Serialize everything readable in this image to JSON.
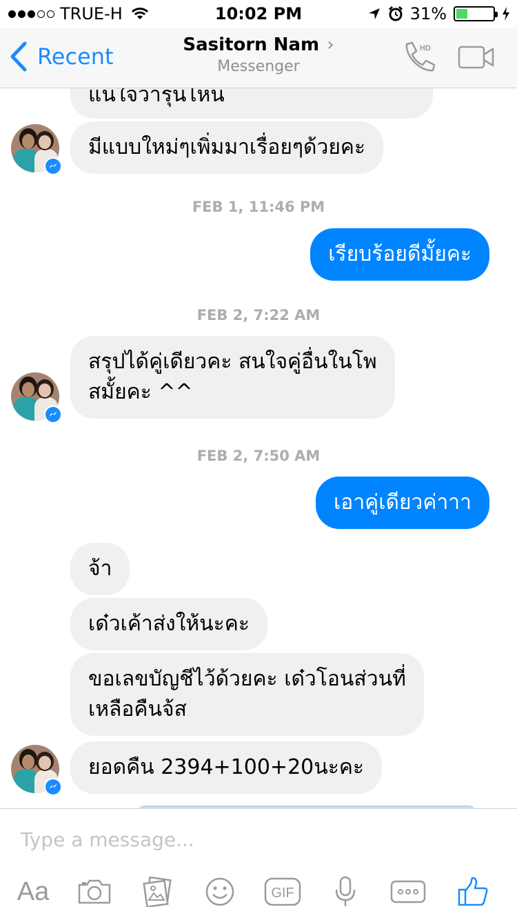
{
  "status_bar": {
    "carrier": "TRUE-H",
    "time": "10:02 PM",
    "battery": "31%",
    "battery_level": 0.31
  },
  "nav": {
    "back_label": "Recent",
    "contact_name": "Sasitorn Nam",
    "subtitle": "Messenger",
    "call_badge": "HD"
  },
  "messages": {
    "m0": "แน่ใจว่ารุ่นไหน",
    "m1": "มีแบบใหม่ๆเพิ่มมาเรื่อยๆด้วยคะ",
    "ts1": "FEB 1, 11:46 PM",
    "m2": "เรียบร้อยดีมั้ยคะ",
    "ts2": "FEB 2, 7:22 AM",
    "m3a": "สรุปได้คู่เดียวคะ สนใจคู่อื่นในโพ",
    "m3b": "สมั้ยคะ ^^",
    "ts3": "FEB 2, 7:50 AM",
    "m4": "เอาคู่เดียวค่าาา",
    "m5": "จ้า",
    "m6": "เด๋วเค้าส่งให้นะคะ",
    "m7a": "ขอเลขบัญชีไว้ด้วยคะ เด๋วโอนส่วนที่",
    "m7b": "เหลือคืนจ้ส",
    "m8": "ยอดคืน 2394+100+20นะคะ"
  },
  "composer": {
    "placeholder": "Type a message...",
    "aa_label": "Aa",
    "gif_label": "GIF"
  },
  "colors": {
    "accent": "#1a8cff",
    "outgoing_bubble": "#0084ff",
    "incoming_bubble": "#f0f0f0",
    "battery_green": "#4cd964"
  },
  "icons": [
    "wifi-icon",
    "location-icon",
    "alarm-icon",
    "battery-icon",
    "back-chevron-icon",
    "phone-hd-icon",
    "video-camera-icon",
    "messenger-badge-icon",
    "camera-icon",
    "photo-gallery-icon",
    "smiley-icon",
    "gif-icon",
    "microphone-icon",
    "more-icon",
    "like-icon"
  ]
}
